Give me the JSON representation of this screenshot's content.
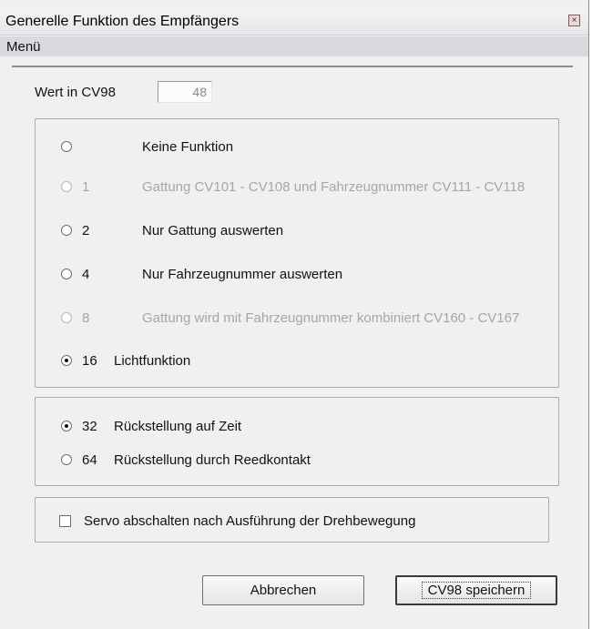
{
  "window": {
    "title": "Generelle Funktion des Empfängers",
    "close_glyph": "×"
  },
  "menu": {
    "items": [
      {
        "label": "Menü"
      }
    ]
  },
  "cv": {
    "label": "Wert in CV98",
    "value": "48"
  },
  "group1": {
    "options": [
      {
        "number": "",
        "label": "Keine Funktion",
        "checked": false,
        "enabled": true
      },
      {
        "number": "1",
        "label": "Gattung CV101 - CV108 und Fahrzeugnummer CV111 - CV118",
        "checked": false,
        "enabled": false
      },
      {
        "number": "2",
        "label": "Nur Gattung auswerten",
        "checked": false,
        "enabled": true
      },
      {
        "number": "4",
        "label": "Nur Fahrzeugnummer auswerten",
        "checked": false,
        "enabled": true
      },
      {
        "number": "8",
        "label": "Gattung wird mit Fahrzeugnummer kombiniert CV160 - CV167",
        "checked": false,
        "enabled": false
      },
      {
        "number": "16",
        "label": "Lichtfunktion",
        "checked": true,
        "enabled": true
      }
    ]
  },
  "group2": {
    "options": [
      {
        "number": "32",
        "label": "Rückstellung auf Zeit",
        "checked": true,
        "enabled": true
      },
      {
        "number": "64",
        "label": "Rückstellung durch Reedkontakt",
        "checked": false,
        "enabled": true
      }
    ]
  },
  "servo_checkbox": {
    "label": "Servo abschalten nach Ausführung der Drehbewegung",
    "checked": false
  },
  "buttons": {
    "cancel": "Abbrechen",
    "save": "CV98 speichern"
  }
}
